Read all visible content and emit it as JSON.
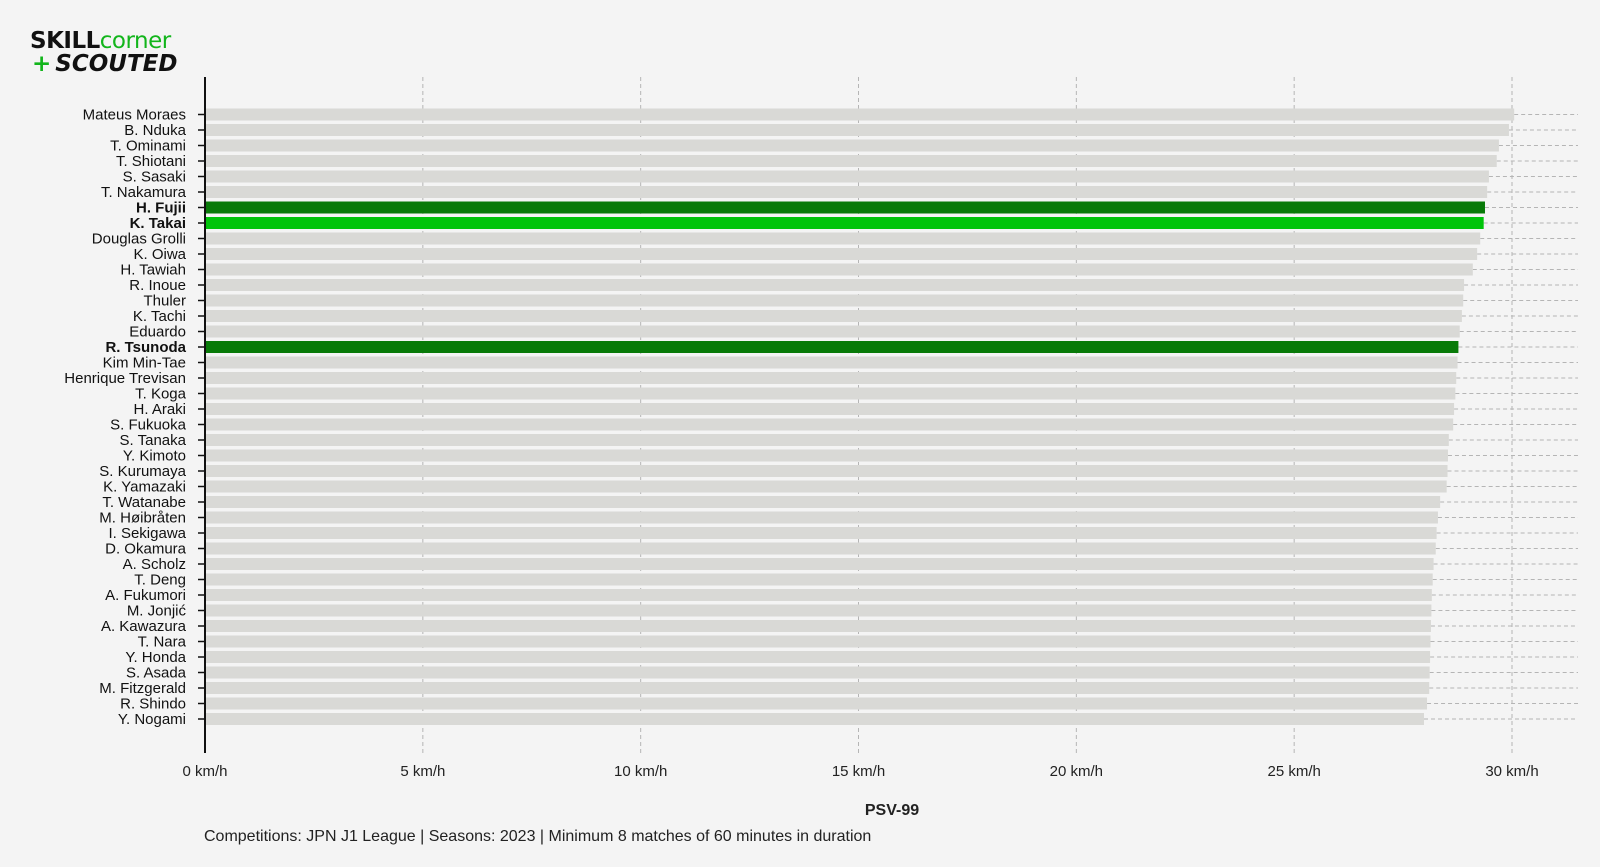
{
  "logo": {
    "line1_a": "SKILL",
    "line1_b": "corner",
    "line2_plus": "+",
    "line2_text": "SCOUTED"
  },
  "caption": "Competitions: JPN J1 League | Seasons: 2023 | Minimum 8 matches of 60 minutes in duration",
  "colors": {
    "background": "#f4f4f4",
    "bar_default": "#d9d9d6",
    "highlight_dark": "#087a08",
    "highlight_light": "#00c40a",
    "axis": "#111111",
    "grid": "#b5b5b5"
  },
  "chart_data": {
    "type": "bar",
    "orientation": "horizontal",
    "xlabel": "PSV-99",
    "xlim": [
      0,
      30
    ],
    "xticks": [
      0,
      5,
      10,
      15,
      20,
      25,
      30
    ],
    "xtick_labels": [
      "0 km/h",
      "5 km/h",
      "10 km/h",
      "15 km/h",
      "20 km/h",
      "25 km/h",
      "30 km/h"
    ],
    "grid": true,
    "categories": [
      "Mateus Moraes",
      "B. Nduka",
      "T. Ominami",
      "T. Shiotani",
      "S. Sasaki",
      "T. Nakamura",
      "H. Fujii",
      "K. Takai",
      "Douglas Grolli",
      "K. Oiwa",
      "H. Tawiah",
      "R. Inoue",
      "Thuler",
      "K. Tachi",
      "Eduardo",
      "R. Tsunoda",
      "Kim Min-Tae",
      "Henrique Trevisan",
      "T. Koga",
      "H. Araki",
      "S. Fukuoka",
      "S. Tanaka",
      "Y. Kimoto",
      "S. Kurumaya",
      "K. Yamazaki",
      "T. Watanabe",
      "M. Høibråten",
      "I. Sekigawa",
      "D. Okamura",
      "A. Scholz",
      "T. Deng",
      "A. Fukumori",
      "M. Jonjić",
      "A. Kawazura",
      "T. Nara",
      "Y. Honda",
      "S. Asada",
      "M. Fitzgerald",
      "R. Shindo",
      "Y. Nogami"
    ],
    "values": [
      30.05,
      29.93,
      29.7,
      29.65,
      29.47,
      29.43,
      29.38,
      29.35,
      29.27,
      29.2,
      29.1,
      28.9,
      28.88,
      28.85,
      28.8,
      28.77,
      28.75,
      28.72,
      28.7,
      28.67,
      28.65,
      28.55,
      28.53,
      28.52,
      28.5,
      28.35,
      28.3,
      28.27,
      28.25,
      28.2,
      28.18,
      28.16,
      28.15,
      28.14,
      28.13,
      28.12,
      28.11,
      28.1,
      28.05,
      27.98
    ],
    "highlights": [
      {
        "name": "H. Fujii",
        "color": "#087a08"
      },
      {
        "name": "K. Takai",
        "color": "#00c40a"
      },
      {
        "name": "R. Tsunoda",
        "color": "#087a08"
      }
    ]
  }
}
